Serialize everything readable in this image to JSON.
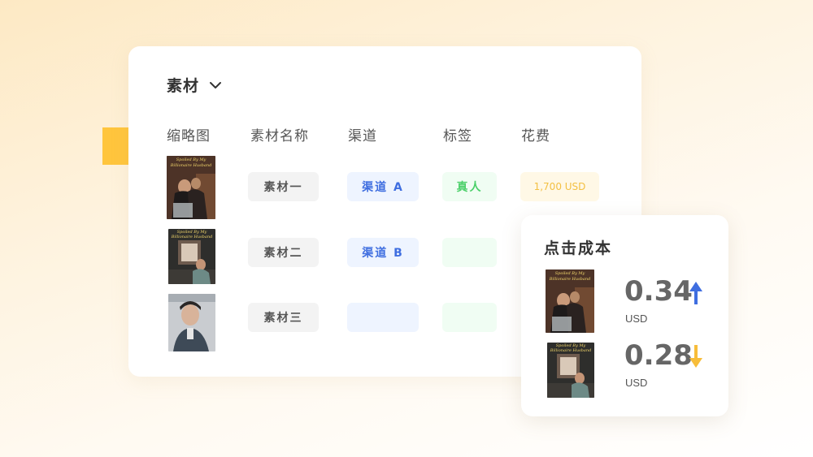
{
  "main_card": {
    "title": "素材",
    "columns": [
      "缩略图",
      "素材名称",
      "渠道",
      "标签",
      "花费"
    ],
    "rows": [
      {
        "thumb_caption": "Spoiled By My Billionaire Husband",
        "name": "素材一",
        "channel": "渠道 A",
        "tag": "真人",
        "cost": "1,700 USD"
      },
      {
        "thumb_caption": "Spoiled By My Billionaire Husband",
        "name": "素材二",
        "channel": "渠道 B",
        "tag": "",
        "cost": ""
      },
      {
        "thumb_caption": "",
        "name": "素材三",
        "channel": "",
        "tag": "",
        "cost": ""
      }
    ]
  },
  "cost_card": {
    "title": "点击成本",
    "items": [
      {
        "thumb_caption": "Spoiled By My Billionaire Husband",
        "value": "0.34",
        "unit": "USD",
        "trend": "up"
      },
      {
        "thumb_caption": "Spoiled By My Billionaire Husband",
        "value": "0.28",
        "unit": "USD",
        "trend": "down"
      }
    ]
  },
  "colors": {
    "accent_yellow": "#ffc53d",
    "channel_blue": "#3f6ee0",
    "tag_green": "#4cd06a",
    "cost_gold": "#f3c043",
    "arrow_up": "#3f6ee0",
    "arrow_down": "#f7bd3a"
  },
  "icons": {
    "dropdown": "chevron-down-icon",
    "trend_up": "arrow-up-icon",
    "trend_down": "arrow-down-icon"
  }
}
